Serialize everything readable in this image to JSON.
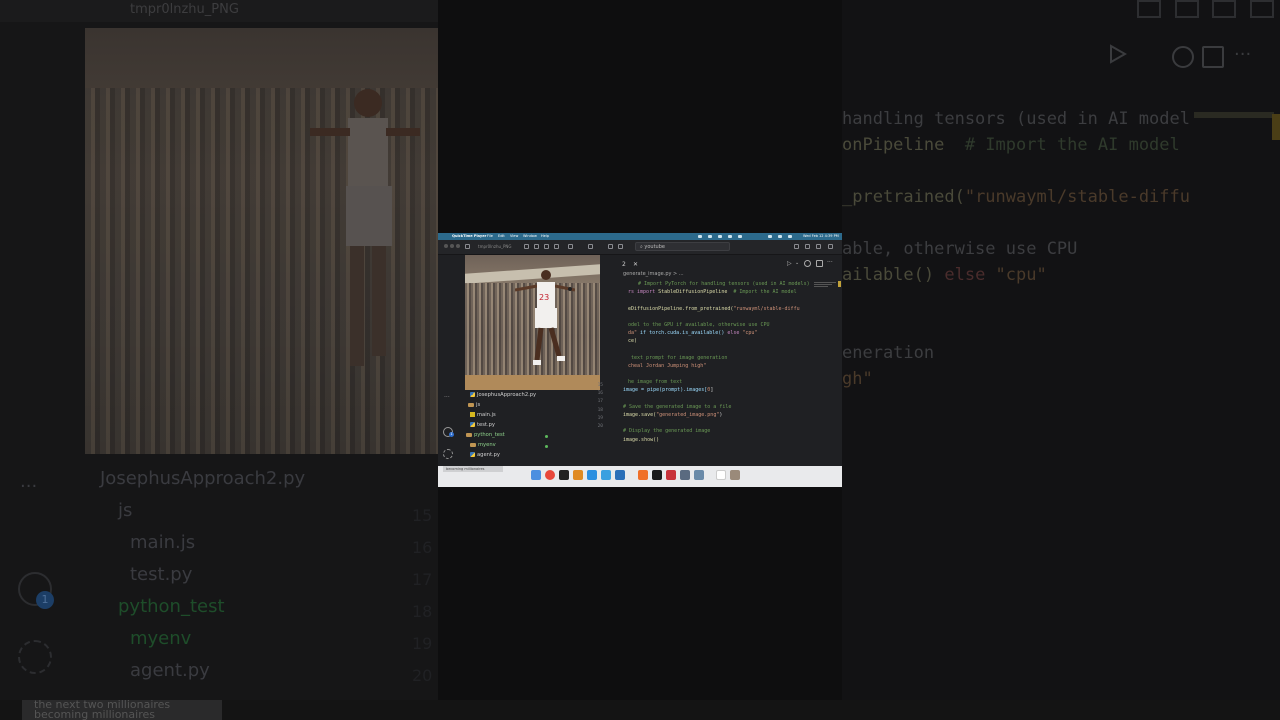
{
  "screen": {
    "menubar": {
      "app": "QuickTime Player",
      "items": [
        "File",
        "Edit",
        "View",
        "Window",
        "Help"
      ],
      "clock": "Wed Feb 12  4:39 PM"
    },
    "toolbar": {
      "file_title": "tmpr0lnzhu_PNG",
      "search_text": "youtube"
    },
    "editor": {
      "tab_close": "✕",
      "tab_number": "2",
      "breadcrumb": "generate_image.py > ...",
      "code_lines": [
        {
          "a": "",
          "b": "# Import PyTorch for handling tensors (used in AI models)",
          "t": "com"
        },
        {
          "a": "rs ",
          "b": "import",
          "c": " StableDiffusionPipeline  ",
          "d": "# Import the AI model",
          "t": "imp"
        },
        {
          "a": "",
          "b": "",
          "t": "blank"
        },
        {
          "a": "eDiffusionPipeline.from_pretrained(",
          "b": "\"runwayml/stable-diffu",
          "t": "pre"
        },
        {
          "a": "",
          "b": "",
          "t": "blank"
        },
        {
          "a": "",
          "b": "odel to the GPU if available, otherwise use CPU",
          "t": "com"
        },
        {
          "a": "da\"",
          "b": " if torch.cuda.is_available() ",
          "c": "else",
          "d": " \"cpu\"",
          "t": "cuda"
        },
        {
          "a": "ce)",
          "b": "",
          "t": "plain"
        },
        {
          "a": "",
          "b": "",
          "t": "blank"
        },
        {
          "a": "",
          "b": " text prompt for image generation",
          "t": "com"
        },
        {
          "a": "",
          "b": "cheal Jordan Jumping high\"",
          "t": "str"
        },
        {
          "a": "",
          "b": "",
          "t": "blank"
        },
        {
          "a": "",
          "b": "he image from text",
          "t": "com"
        },
        {
          "a": "image = pipe(prompt).images[",
          "b": "0",
          "c": "]",
          "t": "img"
        },
        {
          "a": "",
          "b": "",
          "t": "blank"
        },
        {
          "a": "",
          "b": "# Save the generated image to a file",
          "t": "com"
        },
        {
          "a": "image.save(",
          "b": "\"generated_image.png\"",
          "c": ")",
          "t": "save"
        },
        {
          "a": "",
          "b": "",
          "t": "blank"
        },
        {
          "a": "",
          "b": "# Display the generated image",
          "t": "com"
        },
        {
          "a": "image.show()",
          "b": "",
          "t": "plain"
        }
      ],
      "line_numbers": [
        "15",
        "16",
        "17",
        "18",
        "19",
        "20"
      ]
    },
    "explorer": {
      "ellipsis": "···",
      "files": [
        {
          "name": "JosephusApproach2.py",
          "kind": "py",
          "green": false
        },
        {
          "name": "js",
          "kind": "folder",
          "green": false
        },
        {
          "name": "main.js",
          "kind": "js",
          "green": false
        },
        {
          "name": "test.py",
          "kind": "py",
          "green": false
        },
        {
          "name": "python_test",
          "kind": "folder",
          "green": true
        },
        {
          "name": "myenv",
          "kind": "folder",
          "green": true
        },
        {
          "name": "agent.py",
          "kind": "py",
          "green": false
        }
      ],
      "badge": "1"
    },
    "dock": {
      "status_text": "becoming millionaires"
    }
  },
  "background": {
    "left_title": "tmpr0lnzhu_PNG",
    "files": [
      "JosephusApproach2.py",
      "js",
      "main.js",
      "test.py",
      "python_test",
      "myenv",
      "agent.py"
    ],
    "line_numbers": [
      "15",
      "16",
      "17",
      "18",
      "19",
      "20"
    ],
    "badge": "1",
    "code": {
      "line1": "handling tensors (used in AI model",
      "line2a": "onPipeline",
      "line2b": "  # Import the AI model",
      "line3a": "_pretrained(",
      "line3b": "\"runwayml/stable-diffu",
      "line4": "able, otherwise use CPU",
      "line5a": "ailable() ",
      "line5b": "else",
      "line5c": " \"cpu\"",
      "line6": "eneration",
      "line7": "gh\""
    },
    "bottom_note": "the next two millionaires becoming millionaires"
  },
  "colors": {
    "menubar": "#2c6a8c",
    "editor_bg": "#1f2023",
    "comment": "#6a9955",
    "keyword": "#c586c0",
    "string": "#ce9178"
  }
}
